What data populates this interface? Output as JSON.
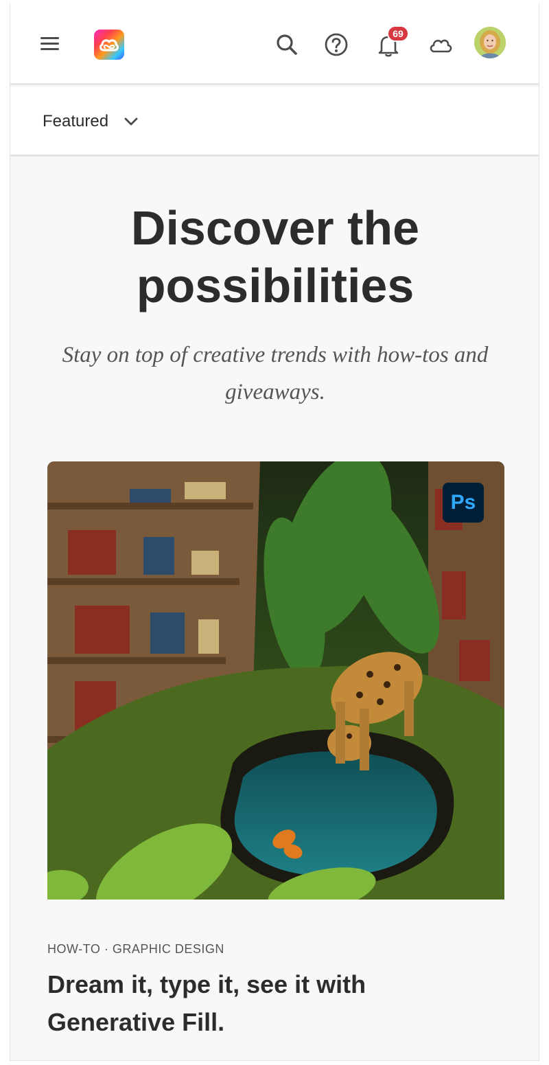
{
  "header": {
    "notification_count": "69",
    "icons": [
      "hamburger-menu-icon",
      "creative-cloud-logo",
      "search-icon",
      "help-icon",
      "bell-icon",
      "cloud-icon",
      "avatar"
    ]
  },
  "filter": {
    "selected": "Featured"
  },
  "hero": {
    "title": "Discover the possibilities",
    "subtitle": "Stay on top of creative trends with how-tos and giveaways."
  },
  "card": {
    "app_badge": "Ps",
    "meta": "HOW-TO · GRAPHIC DESIGN",
    "title": "Dream it, type it, see it with Generative Fill."
  },
  "colors": {
    "badge_red": "#d7373f",
    "ps_dark": "#001e36",
    "ps_blue": "#31a8ff",
    "text_dark": "#2c2c2c",
    "page_bg": "#f8f8f8"
  }
}
